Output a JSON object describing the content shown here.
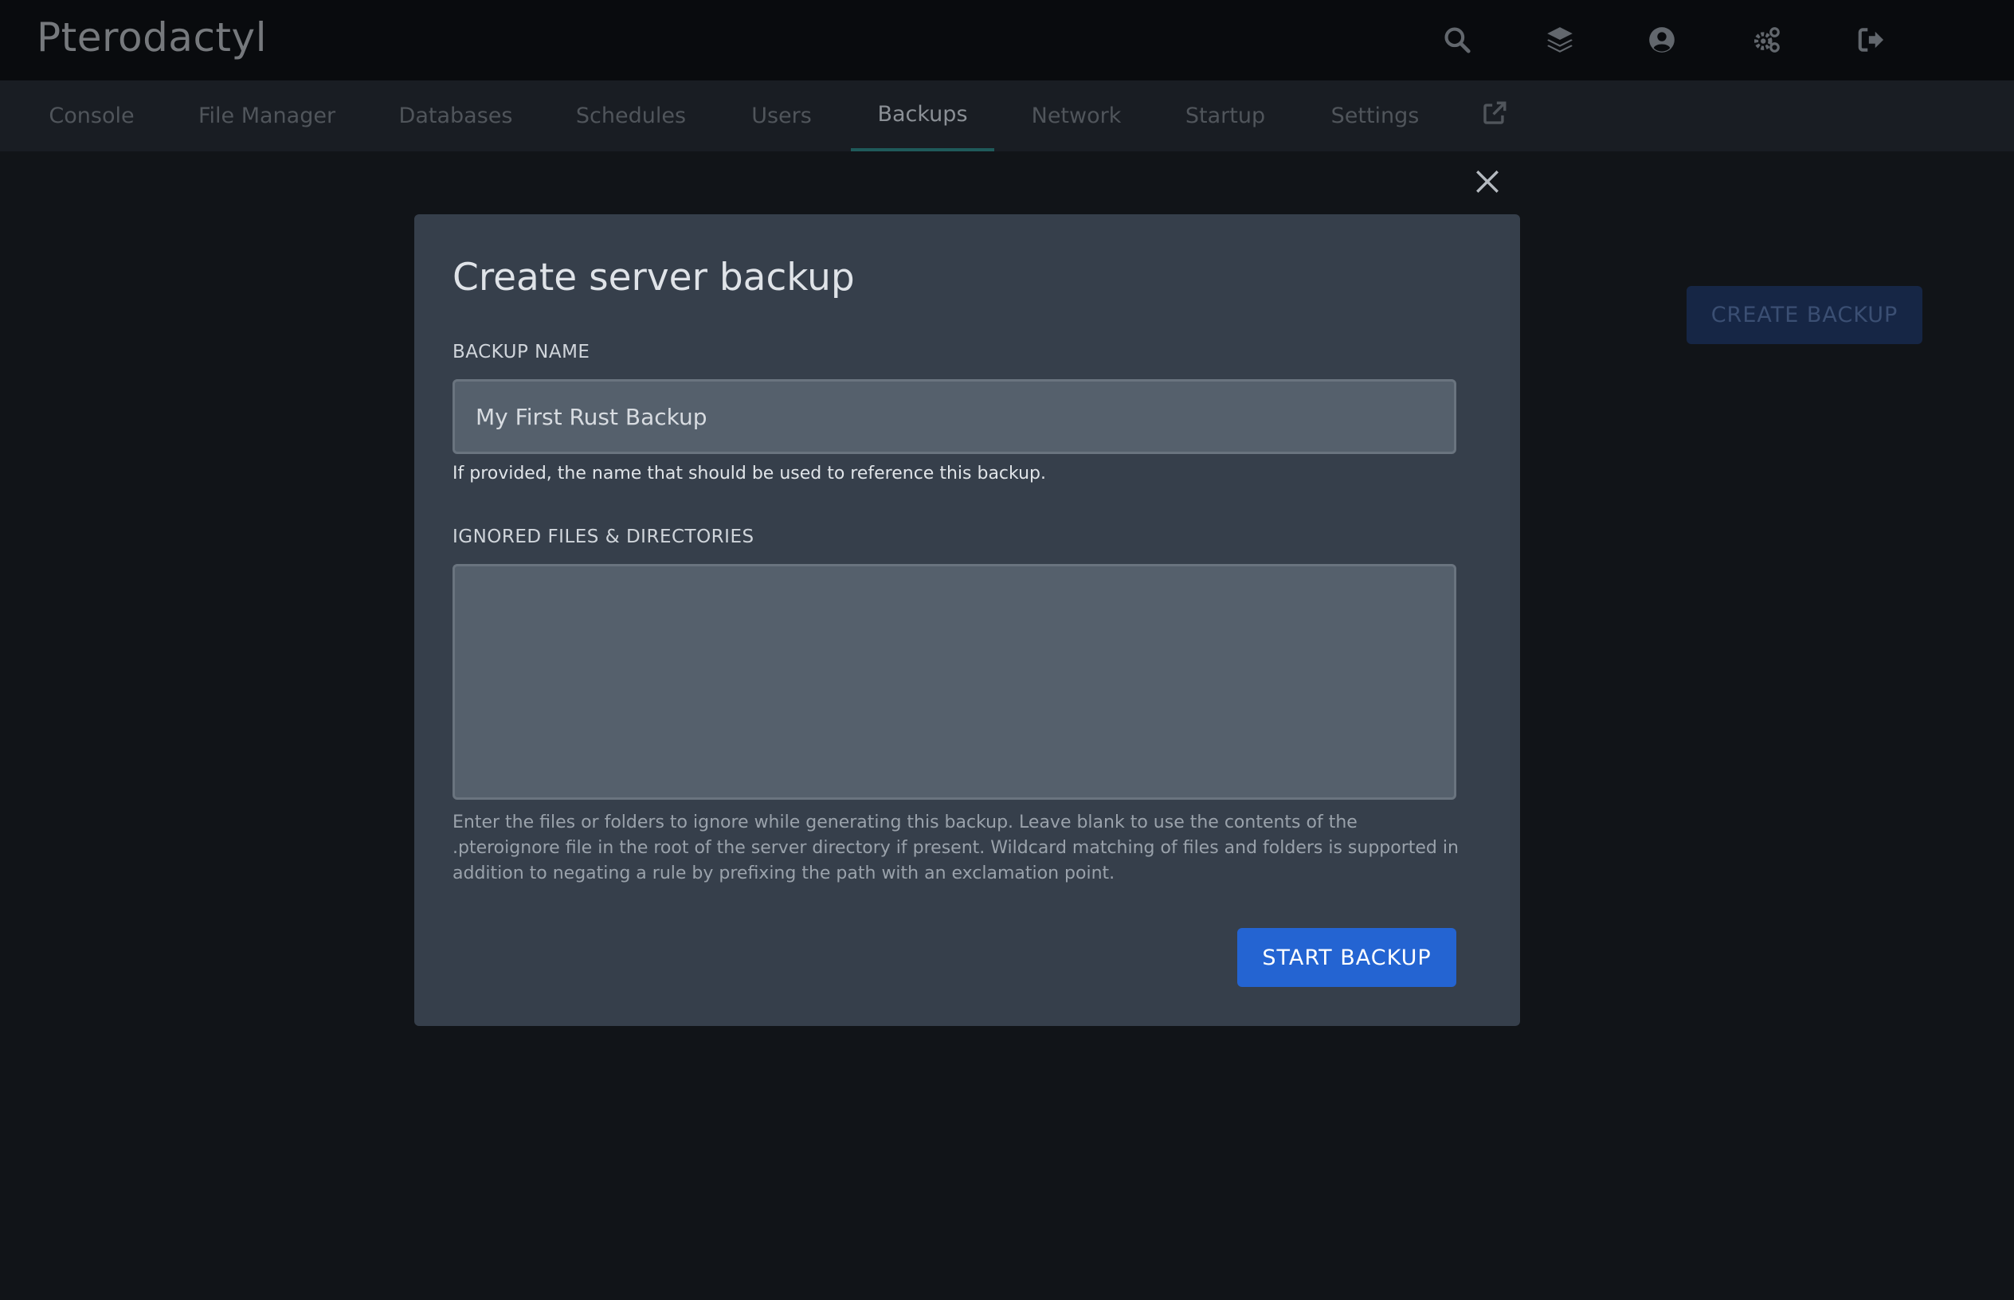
{
  "app": {
    "brand": "Pterodactyl"
  },
  "topbar": {
    "icons": [
      "search-icon",
      "layers-icon",
      "user-circle-icon",
      "cogs-icon",
      "sign-out-icon"
    ]
  },
  "nav": {
    "tabs": [
      {
        "label": "Console"
      },
      {
        "label": "File Manager"
      },
      {
        "label": "Databases"
      },
      {
        "label": "Schedules"
      },
      {
        "label": "Users"
      },
      {
        "label": "Backups"
      },
      {
        "label": "Network"
      },
      {
        "label": "Startup"
      },
      {
        "label": "Settings"
      }
    ],
    "active_tab": "Backups",
    "external_link_icon": "external-link-icon"
  },
  "page": {
    "create_button": "CREATE BACKUP"
  },
  "modal": {
    "title": "Create server backup",
    "backup_name": {
      "label": "BACKUP NAME",
      "value": "My First Rust Backup",
      "helper": "If provided, the name that should be used to reference this backup."
    },
    "ignored": {
      "label": "IGNORED FILES & DIRECTORIES",
      "value": "",
      "helper": "Enter the files or folders to ignore while generating this backup. Leave blank to use the contents of the .pteroignore file in the root of the server directory if present. Wildcard matching of files and folders is supported in addition to negating a rule by prefixing the path with an exclamation point."
    },
    "submit": "START BACKUP",
    "close_icon": "close-icon"
  },
  "colors": {
    "background": "#111418",
    "topbar": "#090b0e",
    "modal": "#363f4b",
    "primary": "#2464d2"
  }
}
